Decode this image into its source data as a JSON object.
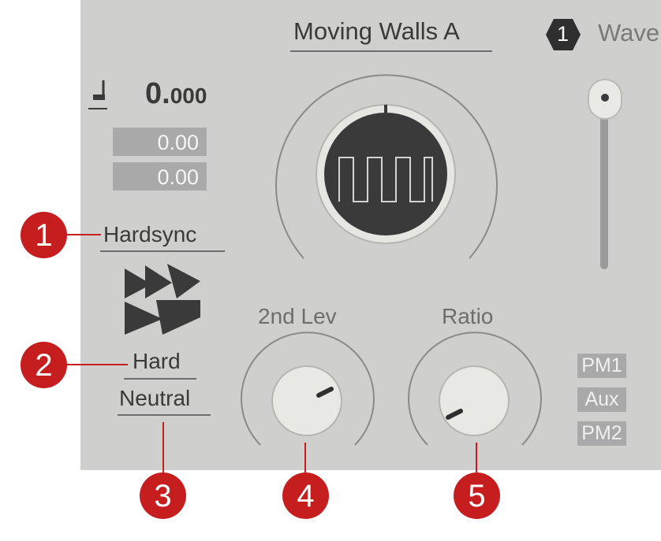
{
  "preset": {
    "title": "Moving Walls A"
  },
  "wave_header": {
    "number": "1",
    "label": "Wave"
  },
  "tempo": {
    "note_glyph": "quarter-note-icon",
    "value_big": "0.",
    "value_small": "000"
  },
  "offsets": {
    "value1": "0.00",
    "value2": "0.00"
  },
  "mode": {
    "hardsync_label": "Hardsync",
    "mode_label": "Hard",
    "character_label": "Neutral",
    "icon": "fast-forward-icon"
  },
  "knobs": {
    "second_level_label": "2nd Lev",
    "ratio_label": "Ratio"
  },
  "mod_tags": [
    "PM1",
    "Aux",
    "PM2"
  ],
  "callouts": [
    "1",
    "2",
    "3",
    "4",
    "5"
  ],
  "colors": {
    "panel": "#cfcfcd",
    "callout": "#c61e1e",
    "dark_knob": "#3a3a3a",
    "tag": "#a9a9a9"
  }
}
